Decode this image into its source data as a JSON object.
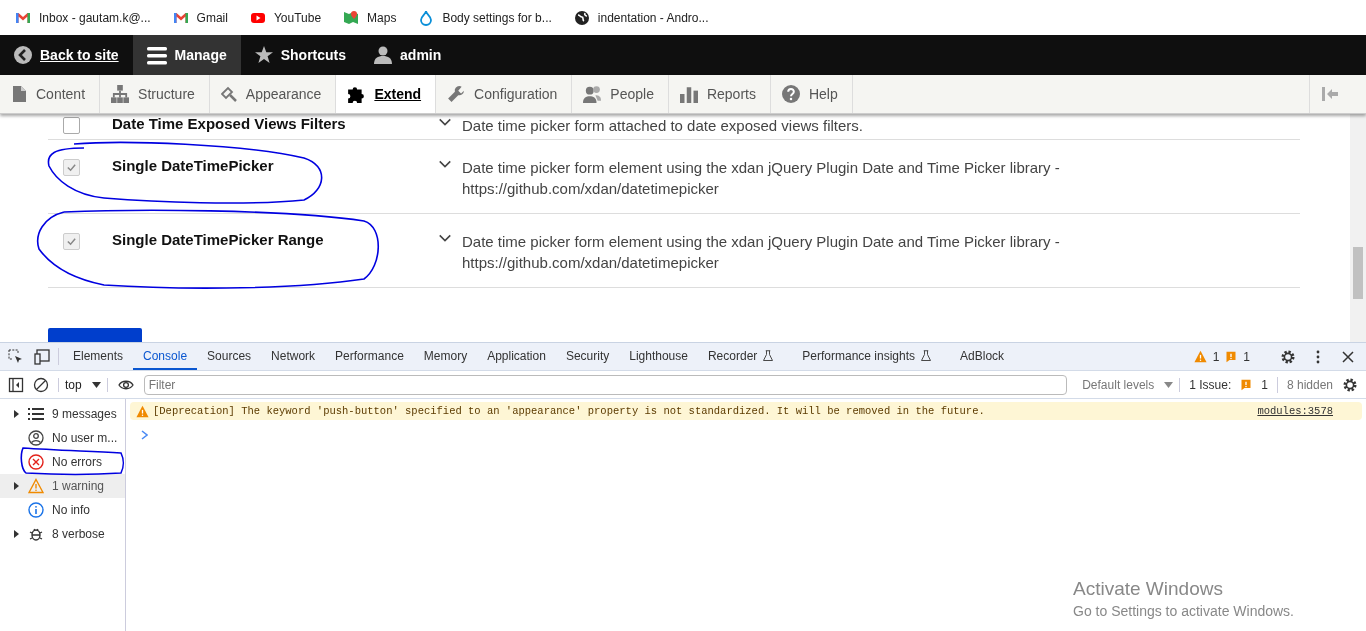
{
  "bookmarks": [
    {
      "label": "Inbox - gautam.k@...",
      "kind": "mail"
    },
    {
      "label": "Gmail",
      "kind": "mail"
    },
    {
      "label": "YouTube",
      "kind": "video"
    },
    {
      "label": "Maps",
      "kind": "map"
    },
    {
      "label": "Body settings for b...",
      "kind": "drop"
    },
    {
      "label": "indentation - Andro...",
      "kind": "globe"
    }
  ],
  "toolbar": {
    "items": [
      {
        "label": "Back to site",
        "kind": "back",
        "selected": false
      },
      {
        "label": "Manage",
        "kind": "menu",
        "selected": true
      },
      {
        "label": "Shortcuts",
        "kind": "star",
        "selected": false
      },
      {
        "label": "admin",
        "kind": "user",
        "selected": false
      }
    ]
  },
  "tray": {
    "tabs": [
      {
        "label": "Content",
        "kind": "file",
        "selected": false
      },
      {
        "label": "Structure",
        "kind": "tree",
        "selected": false
      },
      {
        "label": "Appearance",
        "kind": "brush",
        "selected": false
      },
      {
        "label": "Extend",
        "kind": "puzzle",
        "selected": true
      },
      {
        "label": "Configuration",
        "kind": "wrench",
        "selected": false
      },
      {
        "label": "People",
        "kind": "people",
        "selected": false
      },
      {
        "label": "Reports",
        "kind": "bars",
        "selected": false
      },
      {
        "label": "Help",
        "kind": "help",
        "selected": false
      }
    ]
  },
  "modules": [
    {
      "name": "Date Time Exposed Views Filters",
      "description": "Date time picker form attached to date exposed views filters.",
      "checked": false,
      "disabled": false
    },
    {
      "name": "Single DateTimePicker",
      "description": "Date time picker form element using the xdan jQuery Plugin Date and Time Picker library - https://github.com/xdan/datetimepicker",
      "checked": true,
      "disabled": true
    },
    {
      "name": "Single DateTimePicker Range",
      "description": "Date time picker form element using the xdan jQuery Plugin Date and Time Picker library - https://github.com/xdan/datetimepicker",
      "checked": true,
      "disabled": true
    }
  ],
  "devtools": {
    "tabs": [
      {
        "label": "Elements",
        "selected": false,
        "experimental": false
      },
      {
        "label": "Console",
        "selected": true,
        "experimental": false
      },
      {
        "label": "Sources",
        "selected": false,
        "experimental": false
      },
      {
        "label": "Network",
        "selected": false,
        "experimental": false
      },
      {
        "label": "Performance",
        "selected": false,
        "experimental": false
      },
      {
        "label": "Memory",
        "selected": false,
        "experimental": false
      },
      {
        "label": "Application",
        "selected": false,
        "experimental": false
      },
      {
        "label": "Security",
        "selected": false,
        "experimental": false
      },
      {
        "label": "Lighthouse",
        "selected": false,
        "experimental": false
      },
      {
        "label": "Recorder",
        "selected": false,
        "experimental": true
      },
      {
        "label": "Performance insights",
        "selected": false,
        "experimental": true
      },
      {
        "label": "AdBlock",
        "selected": false,
        "experimental": false
      }
    ],
    "warning_count": "1",
    "issue_count": "1",
    "console_toolbar": {
      "context": "top",
      "filter": {
        "placeholder": "Filter"
      },
      "levels": "Default levels",
      "issues_label": "1 Issue:",
      "issues_count": "1",
      "hidden": "8 hidden"
    },
    "sidebar": [
      {
        "label": "9 messages",
        "kind": "list",
        "expandable": true,
        "selected": false
      },
      {
        "label": "No user m...",
        "kind": "user",
        "expandable": false,
        "selected": false
      },
      {
        "label": "No errors",
        "kind": "error",
        "expandable": false,
        "selected": false
      },
      {
        "label": "1 warning",
        "kind": "warning",
        "expandable": true,
        "selected": true
      },
      {
        "label": "No info",
        "kind": "info",
        "expandable": false,
        "selected": false
      },
      {
        "label": "8 verbose",
        "kind": "bug",
        "expandable": true,
        "selected": false
      }
    ],
    "messages": [
      {
        "kind": "warning",
        "text": "[Deprecation] The keyword 'push-button' specified to an 'appearance' property is not standardized. It will be removed in the future.",
        "source": "modules:3578"
      }
    ]
  },
  "os_notice": {
    "title": "Activate Windows",
    "subtitle": "Go to Settings to activate Windows."
  }
}
